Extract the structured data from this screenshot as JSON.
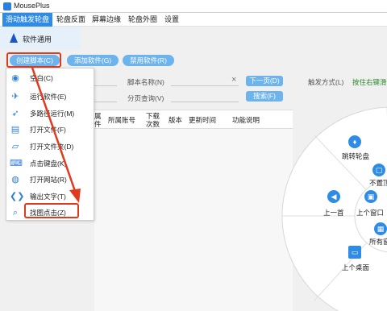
{
  "window": {
    "title": "MousePlus"
  },
  "menu": {
    "tabs": [
      "滑动触发轮盘",
      "轮盘反面",
      "屏幕边缘",
      "轮盘外圈",
      "设置"
    ]
  },
  "subnav": {
    "label": "软件通用"
  },
  "toolbar": {
    "create_script": "创建脚本(C)",
    "add_software": "添加软件(G)",
    "disable_software": "禁用软件(R)"
  },
  "dropdown": {
    "items": [
      {
        "label": "空白(C)",
        "icon": "circle-dot-icon"
      },
      {
        "label": "运行软件(E)",
        "icon": "airplane-icon"
      },
      {
        "label": "多路径运行(M)",
        "icon": "rocket-icon"
      },
      {
        "label": "打开文件(F)",
        "icon": "file-icon"
      },
      {
        "label": "打开文件夹(D)",
        "icon": "folder-icon"
      },
      {
        "label": "点击键盘(K)",
        "icon": "keyboard-icon"
      },
      {
        "label": "打开网站(R)",
        "icon": "globe-icon"
      },
      {
        "label": "输出文字(T)",
        "icon": "code-icon"
      },
      {
        "label": "找图点击(Z)",
        "icon": "search-icon"
      }
    ]
  },
  "filters": {
    "script_name_label": "脚本名称(N)",
    "page_query_label": "分页查询(V)",
    "next_page": "下一页(D)",
    "search": "搜索(F)",
    "trigger_label": "触发方式(L)",
    "trigger_value": "按住右键滑动"
  },
  "table": {
    "headers": [
      "属\n件",
      "所属账号",
      "下载\n次数",
      "版本",
      "更新时间",
      "功能说明"
    ]
  },
  "wheel": {
    "items": [
      {
        "label": "跳转轮盘",
        "icon": "tie-icon"
      },
      {
        "label": "不置顶",
        "icon": "pin-icon"
      },
      {
        "label": "上一首",
        "icon": "previous-icon"
      },
      {
        "label": "上个窗口",
        "icon": "window-icon"
      },
      {
        "label": "所有窗",
        "icon": "grid-icon"
      },
      {
        "label": "上个桌面",
        "icon": "desktop-icon"
      }
    ]
  }
}
